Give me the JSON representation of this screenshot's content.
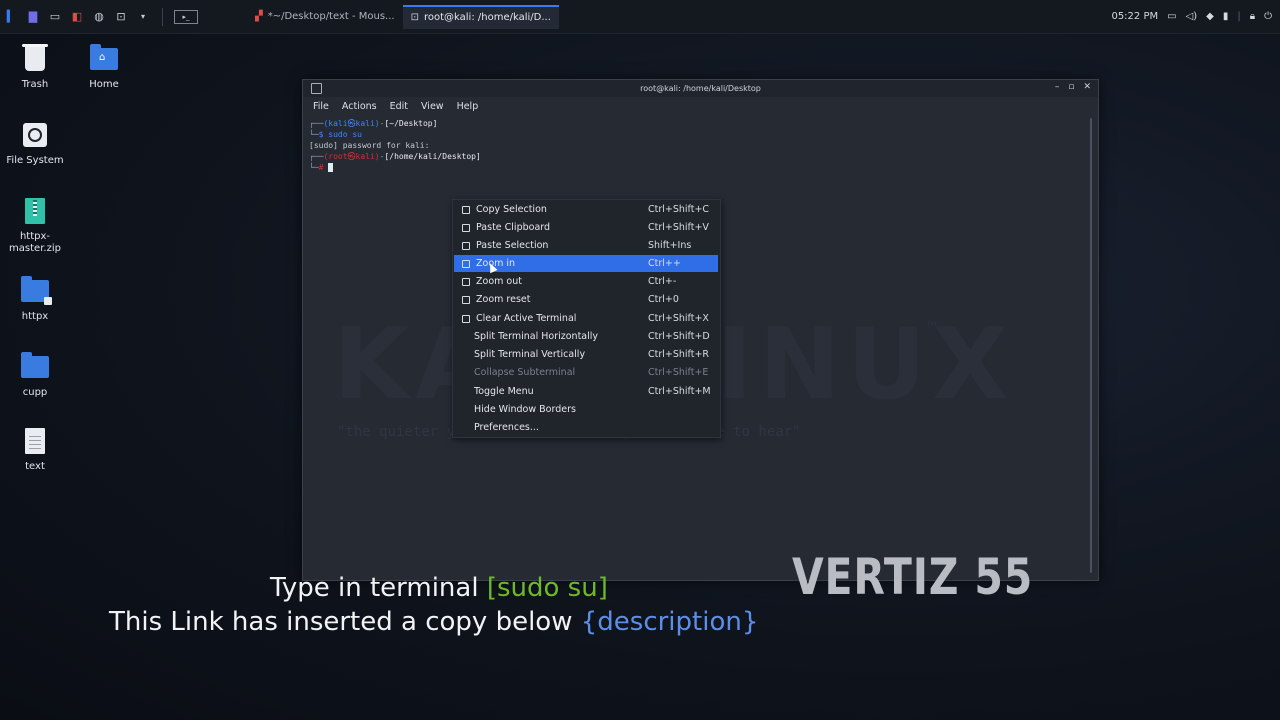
{
  "taskbar": {
    "tasks": [
      {
        "label": "*~/Desktop/text - Mous...",
        "active": false
      },
      {
        "label": "root@kali: /home/kali/D...",
        "active": true
      }
    ],
    "clock": "05:22 PM"
  },
  "desktop": {
    "icons": [
      {
        "label": "Trash"
      },
      {
        "label": "Home"
      },
      {
        "label": "File System"
      },
      {
        "label": "httpx-\nmaster.zip"
      },
      {
        "label": "httpx"
      },
      {
        "label": "cupp"
      },
      {
        "label": "text"
      }
    ]
  },
  "terminal": {
    "title": "root@kali: /home/kali/Desktop",
    "menu": [
      "File",
      "Actions",
      "Edit",
      "View",
      "Help"
    ],
    "lines": {
      "l1_user": "(kali㉿kali)",
      "l1_path": "[~/Desktop]",
      "l2_cmd": "sudo su",
      "l3": "[sudo] password for kali:",
      "l4_user": "(root㉿kali)",
      "l4_path": "[/home/kali/Desktop]"
    },
    "watermark": "KALI LINUX",
    "watermark_quote": "\"the quieter you become, the more you are able to hear\""
  },
  "context_menu": {
    "items": [
      {
        "label": "Copy Selection",
        "shortcut": "Ctrl+Shift+C",
        "icon": true,
        "state": "normal"
      },
      {
        "label": "Paste Clipboard",
        "shortcut": "Ctrl+Shift+V",
        "icon": true,
        "state": "normal"
      },
      {
        "label": "Paste Selection",
        "shortcut": "Shift+Ins",
        "icon": true,
        "state": "normal"
      },
      {
        "label": "Zoom in",
        "shortcut": "Ctrl++",
        "icon": true,
        "state": "highlighted"
      },
      {
        "label": "Zoom out",
        "shortcut": "Ctrl+-",
        "icon": true,
        "state": "normal"
      },
      {
        "label": "Zoom reset",
        "shortcut": "Ctrl+0",
        "icon": true,
        "state": "normal"
      },
      {
        "label": "Clear Active Terminal",
        "shortcut": "Ctrl+Shift+X",
        "icon": true,
        "state": "normal"
      },
      {
        "label": "Split Terminal Horizontally",
        "shortcut": "Ctrl+Shift+D",
        "icon": false,
        "state": "normal"
      },
      {
        "label": "Split Terminal Vertically",
        "shortcut": "Ctrl+Shift+R",
        "icon": false,
        "state": "normal"
      },
      {
        "label": "Collapse Subterminal",
        "shortcut": "Ctrl+Shift+E",
        "icon": false,
        "state": "disabled"
      },
      {
        "label": "Toggle Menu",
        "shortcut": "Ctrl+Shift+M",
        "icon": false,
        "state": "normal"
      },
      {
        "label": "Hide Window Borders",
        "shortcut": "",
        "icon": false,
        "state": "normal"
      },
      {
        "label": "Preferences...",
        "shortcut": "",
        "icon": false,
        "state": "normal"
      }
    ]
  },
  "captions": {
    "line1_text": "Type in terminal ",
    "line1_highlight": "[sudo su]",
    "line2_text": "This Link has inserted a copy below ",
    "line2_highlight": "{description}",
    "brand": "VERTIZ 55"
  },
  "colors": {
    "accent": "#2f6ee6",
    "caption_green": "#6fb82a",
    "caption_blue": "#5c8ee8"
  }
}
